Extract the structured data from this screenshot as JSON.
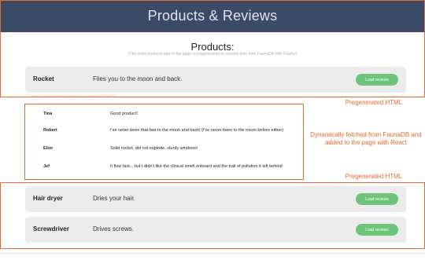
{
  "header": {
    "title": "Products & Reviews"
  },
  "products_section": {
    "title": "Products:",
    "subtitle": "(The initial products part of the page is pregenerated at compile time from FaunaDB with Gatsby)"
  },
  "products": [
    {
      "name": "Rocket",
      "description": "Flies you to the moon and back.",
      "button": "Load reviews"
    },
    {
      "name": "Hair dryer",
      "description": "Dries your hair.",
      "button": "Load reviews"
    },
    {
      "name": "Screwdriver",
      "description": "Drives screws.",
      "button": "Load reviews"
    }
  ],
  "reviews_note": "(These reviews are loaded dynamically by querying FaunaDB)",
  "reviews": [
    {
      "name": "Tina",
      "text": "Good product!"
    },
    {
      "name": "Robert",
      "text": "I've never been that fast to the moon and back! (I've never been to the moon before either)"
    },
    {
      "name": "Elon",
      "text": "Solid rocket, did not explode, sturdy windows!"
    },
    {
      "name": "Jef",
      "text": "It flew fast... but I didn't like the clinical smell onboard and the trail of pollution it left behind"
    }
  ],
  "annotations": {
    "pregenerated_1": "Pregenerated HTML",
    "dynamic": "Dynamically fetched from FaunaDB and added to the page with React",
    "pregenerated_2": "Pregenerated HTML"
  },
  "colors": {
    "header_bg": "#3b4a66",
    "accent_outline": "#e8692f",
    "button_green": "#6dc47a",
    "card_bg": "#ececec"
  }
}
